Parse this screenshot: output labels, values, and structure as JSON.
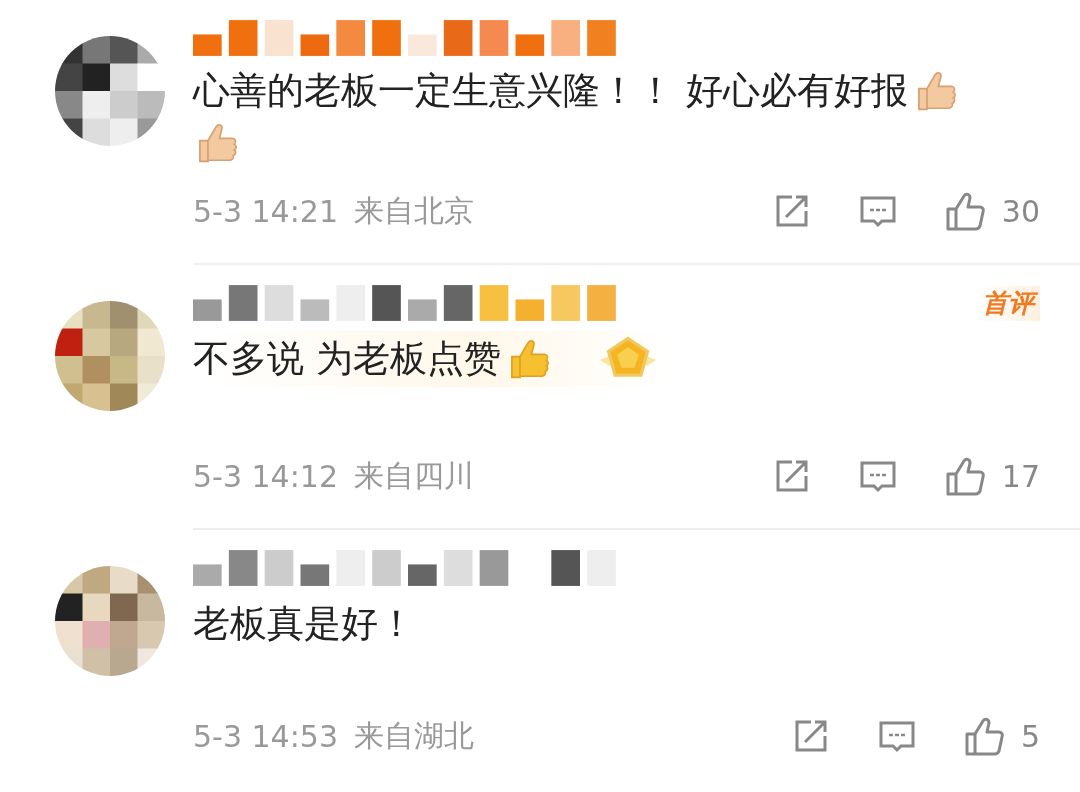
{
  "comments": [
    {
      "username": {
        "kind": "vip"
      },
      "text": "心善的老板一定生意兴隆！！ 好心必有好报",
      "emojis": [
        {
          "kind": "thumbs-up"
        },
        {
          "kind": "thumbs-up"
        }
      ],
      "medal": false,
      "time": "5-3 14:21",
      "location": "来自北京",
      "likes": "30"
    },
    {
      "username": {
        "kind": "plain_vip"
      },
      "first_badge": "首评",
      "text": "不多说 为老板点赞",
      "emojis": [
        {
          "kind": "thumbs-up"
        }
      ],
      "medal": true,
      "time": "5-3 14:12",
      "location": "来自四川",
      "likes": "17"
    },
    {
      "username": {
        "kind": "plain"
      },
      "text": "老板真是好！",
      "medal": false,
      "time": "5-3 14:53",
      "location": "来自湖北",
      "likes": "5"
    }
  ]
}
